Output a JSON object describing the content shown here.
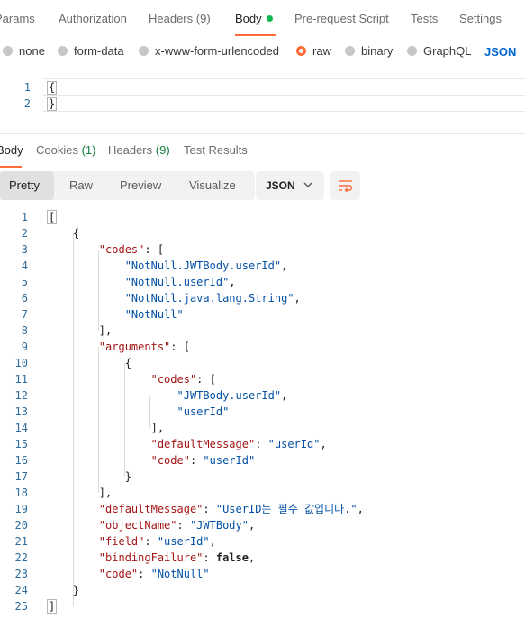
{
  "request_tabs": [
    {
      "label": "Params"
    },
    {
      "label": "Authorization"
    },
    {
      "label": "Headers",
      "count": "(9)"
    },
    {
      "label": "Body",
      "active": true
    },
    {
      "label": "Pre-request Script"
    },
    {
      "label": "Tests"
    },
    {
      "label": "Settings"
    }
  ],
  "body_types": [
    "none",
    "form-data",
    "x-www-form-urlencoded",
    "raw",
    "binary",
    "GraphQL"
  ],
  "selected_body_type": "raw",
  "body_format": "JSON",
  "request_editor": {
    "lines": [
      {
        "num": "1",
        "text": "{"
      },
      {
        "num": "2",
        "text": "}"
      }
    ]
  },
  "response_tabs": [
    {
      "label": "Body",
      "active": true
    },
    {
      "label": "Cookies",
      "count": "(1)"
    },
    {
      "label": "Headers",
      "count": "(9)"
    },
    {
      "label": "Test Results"
    }
  ],
  "view_modes": [
    "Pretty",
    "Raw",
    "Preview",
    "Visualize"
  ],
  "active_view": "Pretty",
  "format_select": "JSON",
  "response_lines": [
    {
      "num": "1",
      "text": "["
    },
    {
      "num": "2",
      "text": "    {"
    },
    {
      "num": "3",
      "text": "        \"codes\": ["
    },
    {
      "num": "4",
      "text": "            \"NotNull.JWTBody.userId\","
    },
    {
      "num": "5",
      "text": "            \"NotNull.userId\","
    },
    {
      "num": "6",
      "text": "            \"NotNull.java.lang.String\","
    },
    {
      "num": "7",
      "text": "            \"NotNull\""
    },
    {
      "num": "8",
      "text": "        ],"
    },
    {
      "num": "9",
      "text": "        \"arguments\": ["
    },
    {
      "num": "10",
      "text": "            {"
    },
    {
      "num": "11",
      "text": "                \"codes\": ["
    },
    {
      "num": "12",
      "text": "                    \"JWTBody.userId\","
    },
    {
      "num": "13",
      "text": "                    \"userId\""
    },
    {
      "num": "14",
      "text": "                ],"
    },
    {
      "num": "15",
      "text": "                \"defaultMessage\": \"userId\","
    },
    {
      "num": "16",
      "text": "                \"code\": \"userId\""
    },
    {
      "num": "17",
      "text": "            }"
    },
    {
      "num": "18",
      "text": "        ],"
    },
    {
      "num": "19",
      "text": "        \"defaultMessage\": \"UserID는 필수 값입니다.\","
    },
    {
      "num": "20",
      "text": "        \"objectName\": \"JWTBody\","
    },
    {
      "num": "21",
      "text": "        \"field\": \"userId\","
    },
    {
      "num": "22",
      "text": "        \"bindingFailure\": false,"
    },
    {
      "num": "23",
      "text": "        \"code\": \"NotNull\""
    },
    {
      "num": "24",
      "text": "    }"
    },
    {
      "num": "25",
      "text": "]"
    }
  ],
  "colors": {
    "accent": "#ff6c37",
    "active_dot": "#0cbb52",
    "count_green": "#0f7f3a",
    "json_link": "#0265d2",
    "line_number": "#2d6c9c",
    "json_key": "#a31515",
    "json_string": "#0451a5"
  },
  "icons": {
    "format_chevron": "chevron-down-icon",
    "wrap_button": "wrap-lines-icon"
  }
}
